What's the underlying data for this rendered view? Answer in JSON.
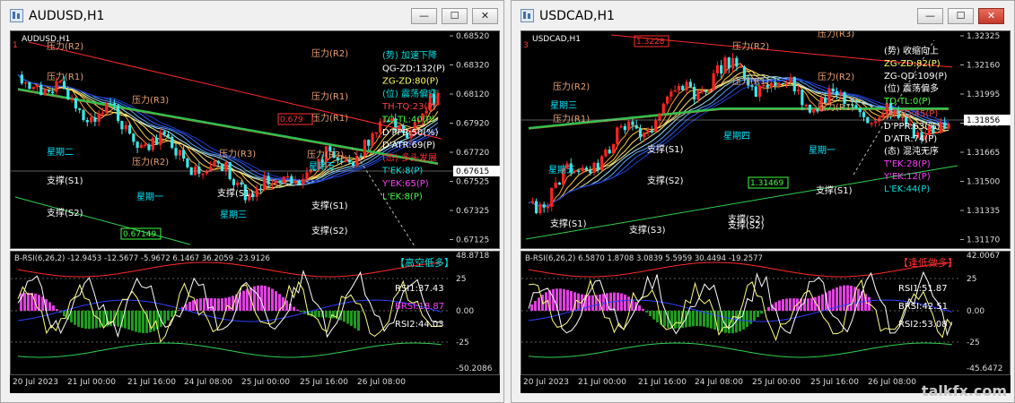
{
  "windows": [
    {
      "id": "left",
      "title": "AUDUSD,H1",
      "symbol_label": "AUDUSD,H1",
      "price_axis": [
        "0.68520",
        "0.68320",
        "0.68120",
        "0.67920",
        "0.67720",
        "0.67525",
        "0.67325",
        "0.67125"
      ],
      "current_price": "0.67615",
      "top_left_marker": "1",
      "levels": [
        {
          "label": "压力(R2)",
          "kind": "r"
        },
        {
          "label": "压力(R1)",
          "kind": "r"
        },
        {
          "label": "压力(R3)",
          "kind": "r"
        },
        {
          "label": "压力(R2)",
          "kind": "r"
        },
        {
          "label": "压力(R1)",
          "kind": "r"
        },
        {
          "label": "压力(R3)",
          "kind": "r"
        },
        {
          "label": "压力(R2)",
          "kind": "r"
        },
        {
          "label": "压力(R1)",
          "kind": "r"
        },
        {
          "label": "压力(R3)",
          "kind": "r"
        },
        {
          "label": "支撑(S1)",
          "kind": "s"
        },
        {
          "label": "支撑(S2)",
          "kind": "s"
        },
        {
          "label": "星期二",
          "kind": "d"
        },
        {
          "label": "星期一",
          "kind": "d"
        },
        {
          "label": "星期三",
          "kind": "d"
        },
        {
          "label": "支撑(S1)",
          "kind": "s"
        },
        {
          "label": "支撑(S1)",
          "kind": "s"
        },
        {
          "label": "支撑(S2)",
          "kind": "s"
        },
        {
          "label": "星期五",
          "kind": "d"
        }
      ],
      "price_box_1": "0.67149",
      "price_box_2": "0.679",
      "info": [
        {
          "text": "(势) 加速下降",
          "color": "#00e0e0"
        },
        {
          "text": "QG-ZD:132(P)",
          "color": "#ffffff"
        },
        {
          "text": "ZG-ZD:80(P)",
          "color": "#ffff66"
        },
        {
          "text": "(位) 震荡偏空",
          "color": "#00e0e0"
        },
        {
          "text": "TH-TQ:23(P)",
          "color": "#ff4040"
        },
        {
          "text": "TO-TL:40(P)",
          "color": "#40ff40"
        },
        {
          "text": "D'PPR:50(%)",
          "color": "#ffffff"
        },
        {
          "text": "D'ATR:69(P)",
          "color": "#ffffff"
        },
        {
          "text": "(态) 多头发展",
          "color": "#ff3030"
        },
        {
          "text": "T'EK:8(P)",
          "color": "#00e0e0"
        },
        {
          "text": "Y'EK:65(P)",
          "color": "#ff40ff"
        },
        {
          "text": "L'EK:8(P)",
          "color": "#40ff40"
        }
      ],
      "rsi_header": "B-RSI(6,26,2) -12.9453 -12.5677 -5.9672 6.1467 36.2059 -23.9126",
      "rsi_axis": [
        "48.8718",
        "25",
        "0.00",
        "-25",
        "-50.2086"
      ],
      "rsi_badge": "【高空低多】",
      "rsi_readouts": [
        {
          "text": "RSI1:37.43",
          "color": "#ffffff"
        },
        {
          "text": "BRSI:18.87",
          "color": "#ff40ff"
        },
        {
          "text": "RSI2:44.03",
          "color": "#ffffff"
        }
      ],
      "time_axis": [
        "20 Jul 2023",
        "21 Jul 00:00",
        "21 Jul 16:00",
        "24 Jul 08:00",
        "25 Jul 00:00",
        "25 Jul 16:00",
        "26 Jul 08:00"
      ],
      "trend": "down"
    },
    {
      "id": "right",
      "title": "USDCAD,H1",
      "symbol_label": "USDCAD,H1",
      "price_axis": [
        "1.32325",
        "1.32160",
        "1.31995",
        "1.31855",
        "1.31665",
        "1.31500",
        "1.31335",
        "1.31170"
      ],
      "current_price": "1.31856",
      "top_left_marker": "3",
      "levels": [
        {
          "label": "压力(R2)",
          "kind": "r"
        },
        {
          "label": "压力(R1)",
          "kind": "r"
        },
        {
          "label": "压力(R2)",
          "kind": "r"
        },
        {
          "label": "压力(R1)",
          "kind": "r"
        },
        {
          "label": "压力(R3)",
          "kind": "r"
        },
        {
          "label": "压力(R2)",
          "kind": "r"
        },
        {
          "label": "压力(R1)",
          "kind": "r"
        },
        {
          "label": "支撑(S1)",
          "kind": "s"
        },
        {
          "label": "支撑(S2)",
          "kind": "s"
        },
        {
          "label": "支撑(S1)",
          "kind": "s"
        },
        {
          "label": "支撑(S2)",
          "kind": "s"
        },
        {
          "label": "支撑(S3)",
          "kind": "s"
        },
        {
          "label": "星期四",
          "kind": "d"
        },
        {
          "label": "星期一",
          "kind": "d"
        },
        {
          "label": "星期三",
          "kind": "d"
        },
        {
          "label": "支撑(S1)",
          "kind": "s"
        },
        {
          "label": "支撑(S2)",
          "kind": "s"
        },
        {
          "label": "星期五",
          "kind": "d"
        }
      ],
      "price_box_1": "1.31469",
      "price_box_2": "1.3228",
      "info": [
        {
          "text": "(势) 收缩向上",
          "color": "#ffffff"
        },
        {
          "text": "ZG-ZD:82(P)",
          "color": "#ffff66"
        },
        {
          "text": "ZG-QD:109(P)",
          "color": "#ffffff"
        },
        {
          "text": "(位) 震荡偏多",
          "color": "#ffffff"
        },
        {
          "text": "TO-TL:0(P)",
          "color": "#40ff40"
        },
        {
          "text": "TH-TQ:45(P)",
          "color": "#ff4040"
        },
        {
          "text": "D'PPR:63(%)",
          "color": "#ffffff"
        },
        {
          "text": "D'ATR:74(P)",
          "color": "#ffffff"
        },
        {
          "text": "(态) 混沌无序",
          "color": "#ffffff"
        },
        {
          "text": "T'EK:28(P)",
          "color": "#ff40ff"
        },
        {
          "text": "Y'EK:12(P)",
          "color": "#ff40ff"
        },
        {
          "text": "L'EK:44(P)",
          "color": "#00e0e0"
        }
      ],
      "rsi_header": "B-RSI(6,26,2) 6.5870 1.8708 3.0839 5.5959 30.4494 -19.2577",
      "rsi_axis": [
        "42.0067",
        "25",
        "0.00",
        "-25",
        "-45.6472"
      ],
      "rsi_badge": "【逢低做多】",
      "rsi_readouts": [
        {
          "text": "RSI1:51.87",
          "color": "#ffffff"
        },
        {
          "text": "BRSI:42.51",
          "color": "#ffffff"
        },
        {
          "text": "RSI2:53.08",
          "color": "#ffffff"
        }
      ],
      "time_axis": [
        "20 Jul 2023",
        "21 Jul 00:00",
        "21 Jul 16:00",
        "24 Jul 08:00",
        "25 Jul 00:00",
        "25 Jul 16:00",
        "26 Jul 08:00"
      ],
      "trend": "up"
    }
  ],
  "window_buttons": {
    "minimize": "—",
    "maximize": "☐",
    "close": "✕"
  },
  "watermark": "talkfx.com"
}
